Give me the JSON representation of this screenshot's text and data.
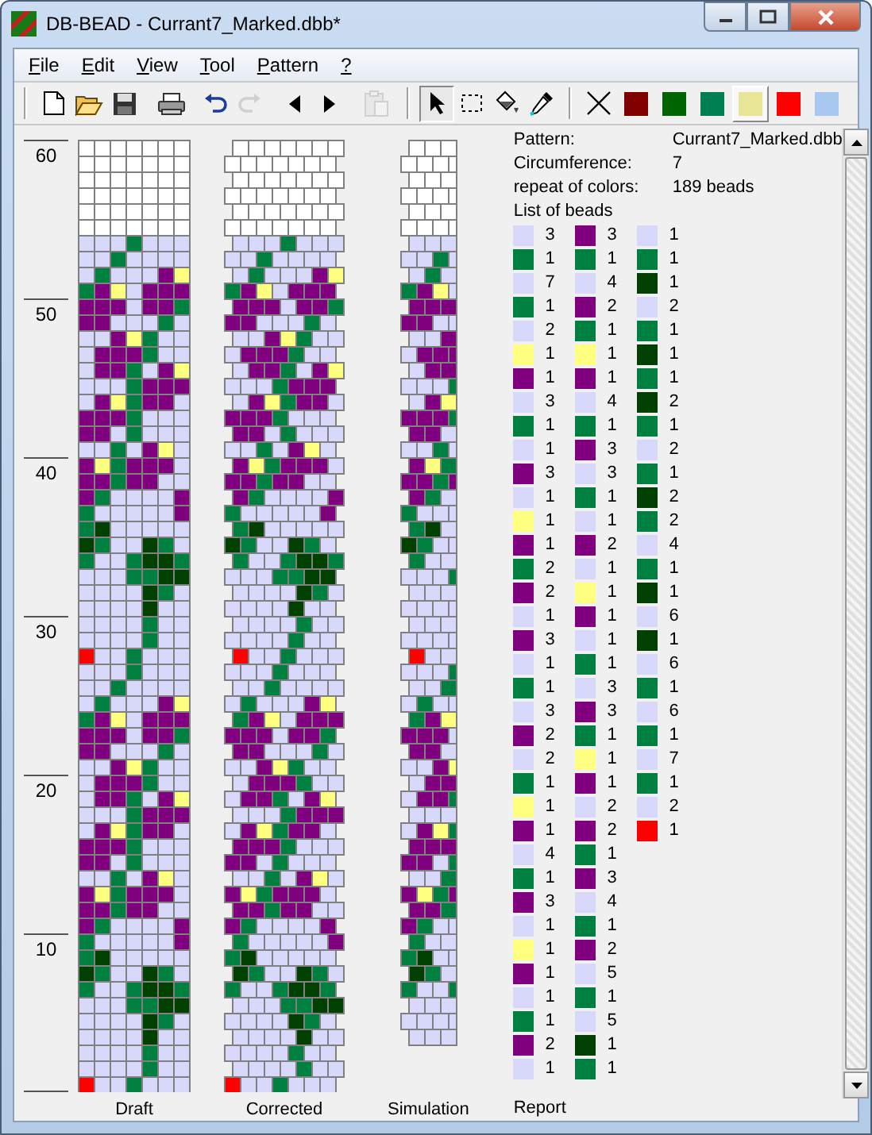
{
  "window": {
    "title": "DB-BEAD - Currant7_Marked.dbb*"
  },
  "menu": [
    {
      "label": "File"
    },
    {
      "label": "Edit"
    },
    {
      "label": "View"
    },
    {
      "label": "Tool"
    },
    {
      "label": "Pattern"
    },
    {
      "label": "?"
    }
  ],
  "toolbar": [
    {
      "kind": "new",
      "disabled": false
    },
    {
      "kind": "open",
      "disabled": false
    },
    {
      "kind": "save",
      "disabled": false
    },
    {
      "kind": "print",
      "disabled": false
    },
    {
      "kind": "undo",
      "disabled": false
    },
    {
      "kind": "redo",
      "disabled": true
    },
    {
      "kind": "left",
      "disabled": false
    },
    {
      "kind": "right",
      "disabled": false
    },
    {
      "kind": "paste",
      "disabled": true
    }
  ],
  "tools": [
    {
      "kind": "pointer",
      "selected": true
    },
    {
      "kind": "select",
      "selected": false
    },
    {
      "kind": "fill",
      "selected": false
    },
    {
      "kind": "picker",
      "selected": false
    }
  ],
  "palette": [
    {
      "color": "#800000",
      "selected": false
    },
    {
      "color": "#006400",
      "selected": false
    },
    {
      "color": "#008050",
      "selected": false
    },
    {
      "color": "#e6e696",
      "selected": true
    },
    {
      "color": "#ff0000",
      "selected": false
    },
    {
      "color": "#a8c8f0",
      "selected": false
    }
  ],
  "ruler": [
    "60",
    "50",
    "40",
    "30",
    "20",
    "10"
  ],
  "views": [
    "Draft",
    "Corrected",
    "Simulation",
    "Report"
  ],
  "report": {
    "fields": [
      {
        "label": "Pattern:",
        "value": "Currant7_Marked.dbb"
      },
      {
        "label": "Circumference:",
        "value": "7"
      },
      {
        "label": "repeat of colors:",
        "value": "189 beads"
      }
    ],
    "list_title": "List of beads",
    "beads": [
      {
        "color": "#d8d8fa",
        "count": "3"
      },
      {
        "color": "#008040",
        "count": "1"
      },
      {
        "color": "#d8d8fa",
        "count": "7"
      },
      {
        "color": "#008040",
        "count": "1"
      },
      {
        "color": "#d8d8fa",
        "count": "2"
      },
      {
        "color": "#ffff80",
        "count": "1"
      },
      {
        "color": "#800080",
        "count": "1"
      },
      {
        "color": "#d8d8fa",
        "count": "3"
      },
      {
        "color": "#008040",
        "count": "1"
      },
      {
        "color": "#d8d8fa",
        "count": "1"
      },
      {
        "color": "#800080",
        "count": "3"
      },
      {
        "color": "#d8d8fa",
        "count": "1"
      },
      {
        "color": "#ffff80",
        "count": "1"
      },
      {
        "color": "#800080",
        "count": "1"
      },
      {
        "color": "#008040",
        "count": "2"
      },
      {
        "color": "#800080",
        "count": "2"
      },
      {
        "color": "#d8d8fa",
        "count": "1"
      },
      {
        "color": "#800080",
        "count": "3"
      },
      {
        "color": "#d8d8fa",
        "count": "1"
      },
      {
        "color": "#008040",
        "count": "1"
      },
      {
        "color": "#d8d8fa",
        "count": "3"
      },
      {
        "color": "#800080",
        "count": "2"
      },
      {
        "color": "#d8d8fa",
        "count": "2"
      },
      {
        "color": "#008040",
        "count": "1"
      },
      {
        "color": "#ffff80",
        "count": "1"
      },
      {
        "color": "#800080",
        "count": "1"
      },
      {
        "color": "#d8d8fa",
        "count": "4"
      },
      {
        "color": "#008040",
        "count": "1"
      },
      {
        "color": "#800080",
        "count": "3"
      },
      {
        "color": "#d8d8fa",
        "count": "1"
      },
      {
        "color": "#ffff80",
        "count": "1"
      },
      {
        "color": "#800080",
        "count": "1"
      },
      {
        "color": "#d8d8fa",
        "count": "1"
      },
      {
        "color": "#008040",
        "count": "1"
      },
      {
        "color": "#800080",
        "count": "2"
      },
      {
        "color": "#d8d8fa",
        "count": "1"
      },
      {
        "color": "#800080",
        "count": "3"
      },
      {
        "color": "#008040",
        "count": "1"
      },
      {
        "color": "#d8d8fa",
        "count": "4"
      },
      {
        "color": "#800080",
        "count": "2"
      },
      {
        "color": "#008040",
        "count": "1"
      },
      {
        "color": "#ffff80",
        "count": "1"
      },
      {
        "color": "#800080",
        "count": "1"
      },
      {
        "color": "#d8d8fa",
        "count": "4"
      },
      {
        "color": "#008040",
        "count": "1"
      },
      {
        "color": "#800080",
        "count": "3"
      },
      {
        "color": "#d8d8fa",
        "count": "3"
      },
      {
        "color": "#008040",
        "count": "1"
      },
      {
        "color": "#d8d8fa",
        "count": "1"
      },
      {
        "color": "#800080",
        "count": "2"
      },
      {
        "color": "#d8d8fa",
        "count": "1"
      },
      {
        "color": "#ffff80",
        "count": "1"
      },
      {
        "color": "#800080",
        "count": "1"
      },
      {
        "color": "#d8d8fa",
        "count": "1"
      },
      {
        "color": "#008040",
        "count": "1"
      },
      {
        "color": "#d8d8fa",
        "count": "3"
      },
      {
        "color": "#800080",
        "count": "3"
      },
      {
        "color": "#008040",
        "count": "1"
      },
      {
        "color": "#ffff80",
        "count": "1"
      },
      {
        "color": "#800080",
        "count": "1"
      },
      {
        "color": "#d8d8fa",
        "count": "2"
      },
      {
        "color": "#800080",
        "count": "2"
      },
      {
        "color": "#008040",
        "count": "1"
      },
      {
        "color": "#800080",
        "count": "3"
      },
      {
        "color": "#d8d8fa",
        "count": "4"
      },
      {
        "color": "#008040",
        "count": "1"
      },
      {
        "color": "#800080",
        "count": "2"
      },
      {
        "color": "#d8d8fa",
        "count": "5"
      },
      {
        "color": "#008040",
        "count": "1"
      },
      {
        "color": "#d8d8fa",
        "count": "5"
      },
      {
        "color": "#004000",
        "count": "1"
      },
      {
        "color": "#008040",
        "count": "1"
      },
      {
        "color": "#d8d8fa",
        "count": "1"
      },
      {
        "color": "#008040",
        "count": "1"
      },
      {
        "color": "#004000",
        "count": "1"
      },
      {
        "color": "#d8d8fa",
        "count": "2"
      },
      {
        "color": "#008040",
        "count": "1"
      },
      {
        "color": "#004000",
        "count": "1"
      },
      {
        "color": "#008040",
        "count": "1"
      },
      {
        "color": "#004000",
        "count": "2"
      },
      {
        "color": "#008040",
        "count": "1"
      },
      {
        "color": "#d8d8fa",
        "count": "2"
      },
      {
        "color": "#008040",
        "count": "1"
      },
      {
        "color": "#004000",
        "count": "2"
      },
      {
        "color": "#008040",
        "count": "2"
      },
      {
        "color": "#d8d8fa",
        "count": "4"
      },
      {
        "color": "#008040",
        "count": "1"
      },
      {
        "color": "#004000",
        "count": "1"
      },
      {
        "color": "#d8d8fa",
        "count": "6"
      },
      {
        "color": "#004000",
        "count": "1"
      },
      {
        "color": "#d8d8fa",
        "count": "6"
      },
      {
        "color": "#008040",
        "count": "1"
      },
      {
        "color": "#d8d8fa",
        "count": "6"
      },
      {
        "color": "#008040",
        "count": "1"
      },
      {
        "color": "#d8d8fa",
        "count": "7"
      },
      {
        "color": "#008040",
        "count": "1"
      },
      {
        "color": "#d8d8fa",
        "count": "2"
      },
      {
        "color": "#ff0000",
        "count": "1"
      }
    ]
  }
}
